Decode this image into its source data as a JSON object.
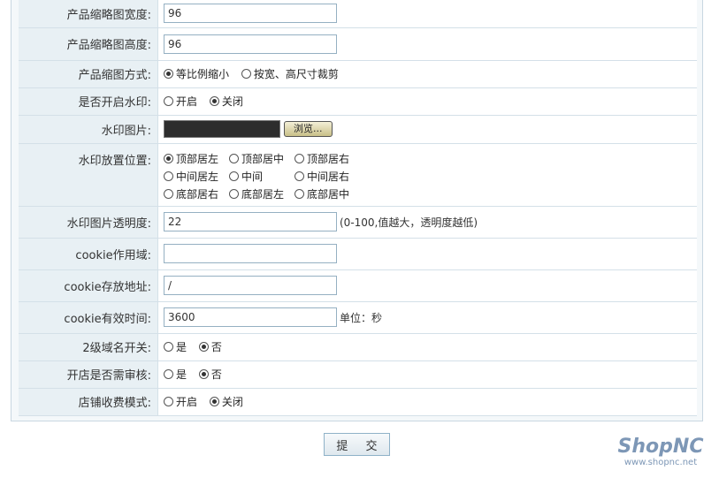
{
  "rows": [
    {
      "label": "产品缩略图宽度:",
      "value": "96"
    },
    {
      "label": "产品缩略图高度:",
      "value": "96"
    },
    {
      "label": "产品缩图方式:",
      "options": [
        "等比例缩小",
        "按宽、高尺寸裁剪"
      ],
      "selected": 0
    },
    {
      "label": "是否开启水印:",
      "options": [
        "开启",
        "关闭"
      ],
      "selected": 1
    },
    {
      "label": "水印图片:",
      "browse": "浏览..."
    },
    {
      "label": "水印放置位置:",
      "options": [
        "顶部居左",
        "顶部居中",
        "顶部居右",
        "中间居左",
        "中间",
        "中间居右",
        "底部居右",
        "底部居左",
        "底部居中"
      ],
      "selected": 0
    },
    {
      "label": "水印图片透明度:",
      "value": "22",
      "hint": "(0-100,值越大，透明度越低)"
    },
    {
      "label": "cookie作用域:",
      "value": ""
    },
    {
      "label": "cookie存放地址:",
      "value": "/"
    },
    {
      "label": "cookie有效时间:",
      "value": "3600",
      "hint": "单位：秒"
    },
    {
      "label": "2级域名开关:",
      "options": [
        "是",
        "否"
      ],
      "selected": 1
    },
    {
      "label": "开店是否需审核:",
      "options": [
        "是",
        "否"
      ],
      "selected": 1
    },
    {
      "label": "店铺收费模式:",
      "options": [
        "开启",
        "关闭"
      ],
      "selected": 1
    }
  ],
  "submit_label": "提 交",
  "logo": {
    "brand": "ShopNC",
    "url": "www.shopnc.net"
  }
}
